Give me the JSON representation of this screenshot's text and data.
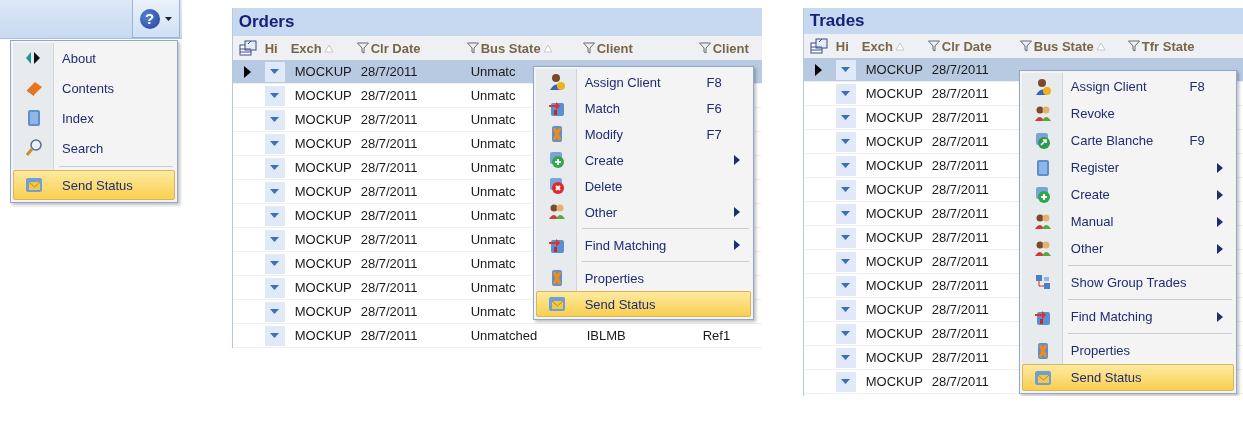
{
  "help": {
    "button": {
      "label": "?"
    },
    "menu": {
      "items": [
        {
          "label": "About",
          "selected": false,
          "separator_before": false
        },
        {
          "label": "Contents",
          "selected": false,
          "separator_before": false
        },
        {
          "label": "Index",
          "selected": false,
          "separator_before": false
        },
        {
          "label": "Search",
          "selected": false,
          "separator_before": false
        },
        {
          "label": "Send Status",
          "selected": true,
          "separator_before": true
        }
      ]
    }
  },
  "orders": {
    "title": "Orders",
    "columns": [
      {
        "label": "Hi",
        "filter": false,
        "sorted": false
      },
      {
        "label": "Exch",
        "filter": false,
        "sorted": true
      },
      {
        "label": "Clr Date",
        "filter": true,
        "sorted": false
      },
      {
        "label": "Bus State",
        "filter": true,
        "sorted": true
      },
      {
        "label": "Client",
        "filter": true,
        "sorted": false
      },
      {
        "label": "Client",
        "filter": true,
        "sorted": false
      }
    ],
    "rows": [
      {
        "selected": true,
        "current": true,
        "cells": [
          "",
          "MOCKUP",
          "28/7/2011",
          "Unmatc"
        ]
      },
      {
        "selected": false,
        "current": false,
        "cells": [
          "",
          "MOCKUP",
          "28/7/2011",
          "Unmatc"
        ]
      },
      {
        "selected": false,
        "current": false,
        "cells": [
          "",
          "MOCKUP",
          "28/7/2011",
          "Unmatc"
        ]
      },
      {
        "selected": false,
        "current": false,
        "cells": [
          "",
          "MOCKUP",
          "28/7/2011",
          "Unmatc"
        ]
      },
      {
        "selected": false,
        "current": false,
        "cells": [
          "",
          "MOCKUP",
          "28/7/2011",
          "Unmatc"
        ]
      },
      {
        "selected": false,
        "current": false,
        "cells": [
          "",
          "MOCKUP",
          "28/7/2011",
          "Unmatc"
        ]
      },
      {
        "selected": false,
        "current": false,
        "cells": [
          "",
          "MOCKUP",
          "28/7/2011",
          "Unmatc"
        ]
      },
      {
        "selected": false,
        "current": false,
        "cells": [
          "",
          "MOCKUP",
          "28/7/2011",
          "Unmatc"
        ]
      },
      {
        "selected": false,
        "current": false,
        "cells": [
          "",
          "MOCKUP",
          "28/7/2011",
          "Unmatc"
        ]
      },
      {
        "selected": false,
        "current": false,
        "cells": [
          "",
          "MOCKUP",
          "28/7/2011",
          "Unmatc"
        ]
      },
      {
        "selected": false,
        "current": false,
        "cells": [
          "",
          "MOCKUP",
          "28/7/2011",
          "Unmatc"
        ]
      },
      {
        "selected": false,
        "current": false,
        "cells": [
          "",
          "MOCKUP",
          "28/7/2011",
          "Unmatched",
          "IBLMB",
          "Ref1"
        ]
      }
    ],
    "menu": {
      "items": [
        {
          "label": "Assign Client",
          "shortcut": "F8",
          "submenu": false,
          "selected": false,
          "separator_before": false
        },
        {
          "label": "Match",
          "shortcut": "F6",
          "submenu": false,
          "selected": false,
          "separator_before": false
        },
        {
          "label": "Modify",
          "shortcut": "F7",
          "submenu": false,
          "selected": false,
          "separator_before": false
        },
        {
          "label": "Create",
          "submenu": true,
          "selected": false,
          "separator_before": false
        },
        {
          "label": "Delete",
          "submenu": false,
          "selected": false,
          "separator_before": false
        },
        {
          "label": "Other",
          "submenu": true,
          "selected": false,
          "separator_before": false
        },
        {
          "label": "Find Matching",
          "submenu": true,
          "selected": false,
          "separator_before": true
        },
        {
          "label": "Properties",
          "submenu": false,
          "selected": false,
          "separator_before": true
        },
        {
          "label": "Send Status",
          "submenu": false,
          "selected": true,
          "separator_before": false
        }
      ]
    }
  },
  "trades": {
    "title": "Trades",
    "columns": [
      {
        "label": "Hi",
        "filter": false,
        "sorted": false
      },
      {
        "label": "Exch",
        "filter": false,
        "sorted": true
      },
      {
        "label": "Clr Date",
        "filter": true,
        "sorted": false
      },
      {
        "label": "Bus State",
        "filter": true,
        "sorted": true
      },
      {
        "label": "Tfr State",
        "filter": true,
        "sorted": false
      }
    ],
    "rows": [
      {
        "selected": true,
        "current": true,
        "cells": [
          "",
          "MOCKUP",
          "28/7/2011"
        ]
      },
      {
        "selected": false,
        "current": false,
        "cells": [
          "",
          "MOCKUP",
          "28/7/2011"
        ]
      },
      {
        "selected": false,
        "current": false,
        "cells": [
          "",
          "MOCKUP",
          "28/7/2011"
        ]
      },
      {
        "selected": false,
        "current": false,
        "cells": [
          "",
          "MOCKUP",
          "28/7/2011"
        ]
      },
      {
        "selected": false,
        "current": false,
        "cells": [
          "",
          "MOCKUP",
          "28/7/2011"
        ]
      },
      {
        "selected": false,
        "current": false,
        "cells": [
          "",
          "MOCKUP",
          "28/7/2011"
        ]
      },
      {
        "selected": false,
        "current": false,
        "cells": [
          "",
          "MOCKUP",
          "28/7/2011"
        ]
      },
      {
        "selected": false,
        "current": false,
        "cells": [
          "",
          "MOCKUP",
          "28/7/2011"
        ]
      },
      {
        "selected": false,
        "current": false,
        "cells": [
          "",
          "MOCKUP",
          "28/7/2011"
        ]
      },
      {
        "selected": false,
        "current": false,
        "cells": [
          "",
          "MOCKUP",
          "28/7/2011"
        ]
      },
      {
        "selected": false,
        "current": false,
        "cells": [
          "",
          "MOCKUP",
          "28/7/2011"
        ]
      },
      {
        "selected": false,
        "current": false,
        "cells": [
          "",
          "MOCKUP",
          "28/7/2011"
        ]
      },
      {
        "selected": false,
        "current": false,
        "cells": [
          "",
          "MOCKUP",
          "28/7/2011"
        ]
      },
      {
        "selected": false,
        "current": false,
        "cells": [
          "",
          "MOCKUP",
          "28/7/2011"
        ]
      }
    ],
    "menu": {
      "items": [
        {
          "label": "Assign Client",
          "shortcut": "F8",
          "submenu": false,
          "selected": false,
          "separator_before": false
        },
        {
          "label": "Revoke",
          "submenu": false,
          "selected": false,
          "separator_before": false
        },
        {
          "label": "Carte Blanche",
          "shortcut": "F9",
          "submenu": false,
          "selected": false,
          "separator_before": false
        },
        {
          "label": "Register",
          "submenu": true,
          "selected": false,
          "separator_before": false
        },
        {
          "label": "Create",
          "submenu": true,
          "selected": false,
          "separator_before": false
        },
        {
          "label": "Manual",
          "submenu": true,
          "selected": false,
          "separator_before": false
        },
        {
          "label": "Other",
          "submenu": true,
          "selected": false,
          "separator_before": false
        },
        {
          "label": "Show Group Trades",
          "submenu": false,
          "selected": false,
          "separator_before": true
        },
        {
          "label": "Find Matching",
          "submenu": true,
          "selected": false,
          "separator_before": true
        },
        {
          "label": "Properties",
          "submenu": false,
          "selected": false,
          "separator_before": true
        },
        {
          "label": "Send Status",
          "submenu": false,
          "selected": true,
          "separator_before": false
        }
      ]
    }
  }
}
